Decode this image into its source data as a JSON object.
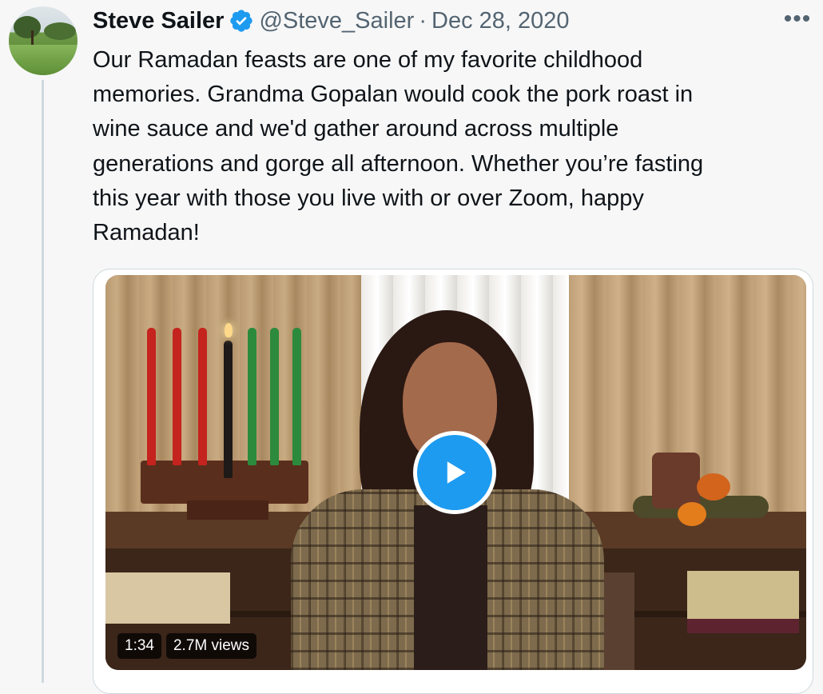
{
  "author": {
    "name": "Steve Sailer",
    "handle": "@Steve_Sailer",
    "separator": "·",
    "date": "Dec 28, 2020",
    "verified_icon": "verified-badge-icon",
    "avatar_icon": "golf-course-avatar"
  },
  "menu": {
    "more_label": "•••"
  },
  "tweet": {
    "text": "Our Ramadan feasts are one of my favorite childhood\nmemories. Grandma Gopalan would cook the pork roast in\nwine sauce and we'd gather around across multiple\ngenerations and gorge all afternoon. Whether you’re fasting\nthis year with those you live with or over Zoom, happy\nRamadan!"
  },
  "media": {
    "type": "video",
    "duration": "1:34",
    "views": "2.7M views",
    "play_icon": "play-icon"
  },
  "colors": {
    "accent": "#1d9bf0",
    "text": "#0f1419",
    "secondary_text": "#536471",
    "background": "#f7f7f7",
    "border": "#cfd9de"
  }
}
